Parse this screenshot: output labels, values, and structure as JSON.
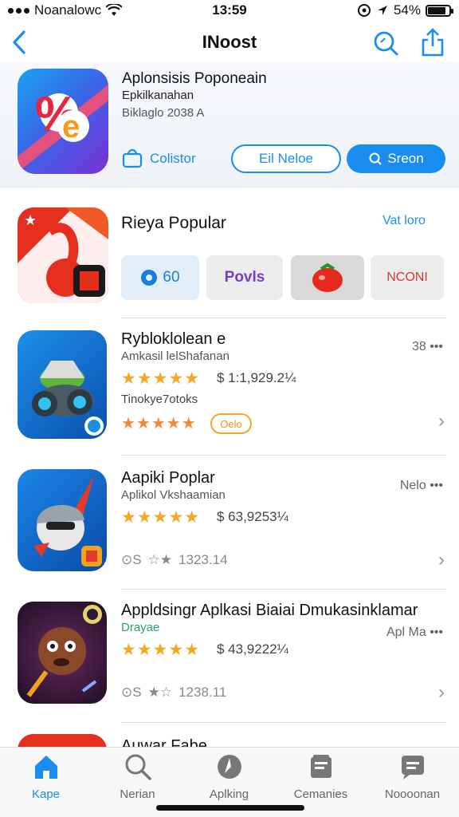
{
  "status": {
    "carrier": "Noanalowc",
    "time": "13:59",
    "battery": "54%",
    "battery_level": 0.84
  },
  "nav": {
    "title": "INoost"
  },
  "hero": {
    "name": "Aplonsisis Poponeain",
    "subtitle": "Epkilkanahan",
    "meta": "Biklaglo 2038 A",
    "shop_label": "Colistor",
    "outline_button": "Eil Neloe",
    "filled_button": "Sreon",
    "accent": "#1a8ef0"
  },
  "popular": {
    "title": "Rieya Popular",
    "link": "Vat loro",
    "chips": [
      "60",
      "Povls",
      "",
      "NCONI"
    ]
  },
  "apps": [
    {
      "name": "Rybloklolean e",
      "developer": "Amkasil lelShafanan",
      "size": "38 ",
      "stars": 5,
      "price": "$ 1:1,929.2¼",
      "extra": "Tinokye7otoks",
      "rating2": 4,
      "badge": "Oelo"
    },
    {
      "name": "Aapiki Poplar",
      "developer": "Aplikol Vkshaamian",
      "size": "Nelo ",
      "stars": 5,
      "price": "$ 63,9253¼",
      "meta2": "1323.14"
    },
    {
      "name": "Appldsingr Aplkasi Biaiai Dmukasinklamar",
      "developer": "Drayae",
      "size": "Apl Ma ",
      "stars": 5,
      "price": "$ 43,9222¼",
      "meta2": "1238.11"
    },
    {
      "name": "Auwar Fabe"
    }
  ],
  "tabs": [
    {
      "label": "Kape",
      "icon": "home-icon"
    },
    {
      "label": "Nerian",
      "icon": "search-icon"
    },
    {
      "label": "Aplking",
      "icon": "compass-icon"
    },
    {
      "label": "Cemanies",
      "icon": "box-icon"
    },
    {
      "label": "Noooonan",
      "icon": "chat-icon"
    }
  ]
}
